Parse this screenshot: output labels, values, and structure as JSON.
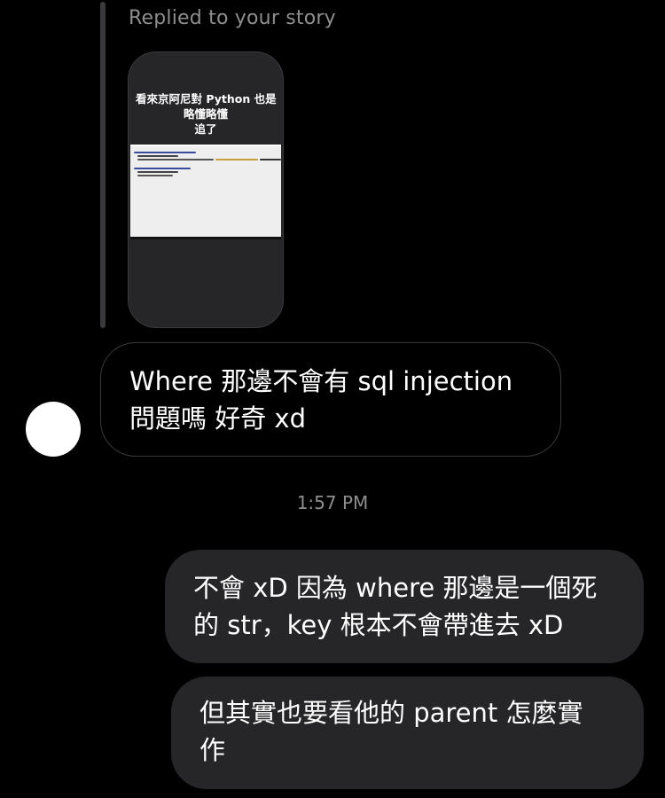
{
  "reply": {
    "label": "Replied to your story"
  },
  "story": {
    "caption_lines": [
      "看來京阿尼對 Python 也是",
      "略懂略懂",
      "追了"
    ]
  },
  "incoming_message": {
    "lines": [
      "Where 那邊不會有 sql injection",
      "問題嗎 好奇 xd"
    ]
  },
  "timestamp": "1:57 PM",
  "outgoing_messages": [
    {
      "lines": [
        "不會 xD 因為 where 那邊是一個死",
        "的 str，key 根本不會帶進去 xD"
      ]
    },
    {
      "lines": [
        "但其實也要看他的 parent 怎麼實",
        "作"
      ]
    }
  ]
}
